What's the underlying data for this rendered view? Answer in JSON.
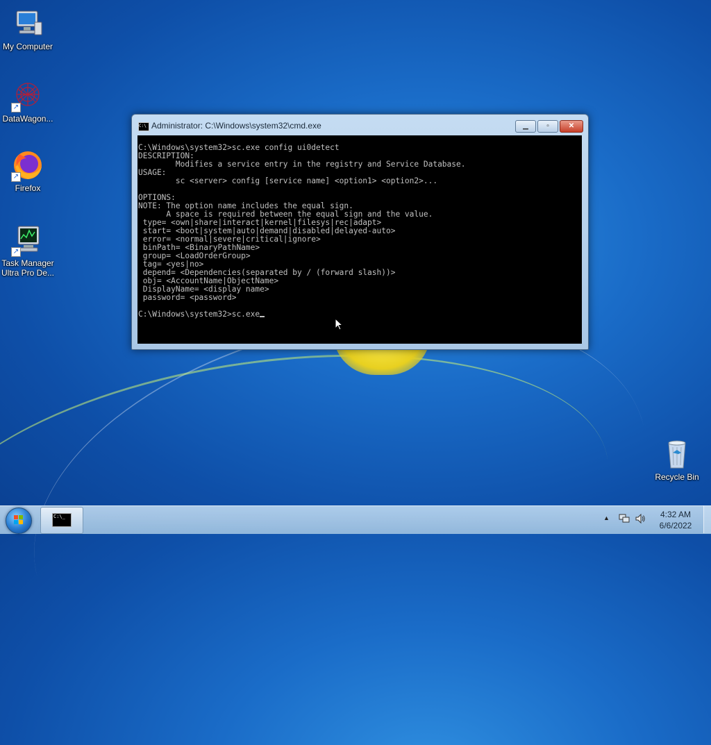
{
  "desktop": {
    "icons": [
      {
        "label": "My Computer",
        "icon": "computer-icon"
      },
      {
        "label": "DataWagon...",
        "icon": "datawagon-icon"
      },
      {
        "label": "Firefox",
        "icon": "firefox-icon"
      },
      {
        "label": "Task Manager Ultra Pro De...",
        "label_line1": "Task Manager",
        "label_line2": "Ultra Pro De...",
        "icon": "task-manager-icon"
      },
      {
        "label": "Recycle Bin",
        "icon": "recycle-bin-icon"
      }
    ]
  },
  "window": {
    "title": "Administrator: C:\\Windows\\system32\\cmd.exe",
    "console_lines": [
      "C:\\Windows\\system32>sc.exe config ui0detect",
      "DESCRIPTION:",
      "        Modifies a service entry in the registry and Service Database.",
      "USAGE:",
      "        sc <server> config [service name] <option1> <option2>...",
      "",
      "OPTIONS:",
      "NOTE: The option name includes the equal sign.",
      "      A space is required between the equal sign and the value.",
      " type= <own|share|interact|kernel|filesys|rec|adapt>",
      " start= <boot|system|auto|demand|disabled|delayed-auto>",
      " error= <normal|severe|critical|ignore>",
      " binPath= <BinaryPathName>",
      " group= <LoadOrderGroup>",
      " tag= <yes|no>",
      " depend= <Dependencies(separated by / (forward slash))>",
      " obj= <AccountName|ObjectName>",
      " DisplayName= <display name>",
      " password= <password>",
      ""
    ],
    "prompt_line": "C:\\Windows\\system32>sc.exe"
  },
  "taskbar": {
    "time": "4:32 AM",
    "date": "6/6/2022",
    "task_button_icon": "cmd-icon",
    "task_button_glyph": "C:\\_"
  },
  "colors": {
    "console_bg": "#000000",
    "console_fg": "#c0c0c0",
    "desktop_blue": "#1a6cc8"
  }
}
